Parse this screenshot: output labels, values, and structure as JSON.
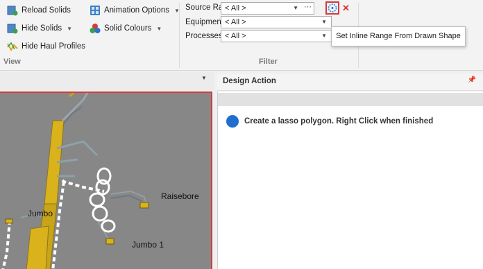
{
  "ribbon": {
    "view_group": {
      "label": "View",
      "reload_solids": "Reload Solids",
      "hide_solids": "Hide Solids",
      "hide_haul_profiles": "Hide Haul Profiles",
      "animation_options": "Animation Options",
      "solid_colours": "Solid Colours"
    },
    "filter_group": {
      "label": "Filter",
      "source_range_label": "Source Range",
      "source_range_value": "< All >",
      "source_range_more": "···",
      "equipment_label": "Equipment",
      "equipment_value": "< All >",
      "processes_label": "Processes",
      "processes_value": "< All >"
    }
  },
  "tooltip": {
    "text": "Set Inline Range From Drawn Shape"
  },
  "viewport": {
    "labels": [
      "Raisebore",
      "Jumbo",
      "Jumbo 1"
    ]
  },
  "design_action": {
    "title": "Design Action",
    "message": "Create a lasso polygon. Right Click when finished",
    "status_color": "#1f6fd0"
  },
  "colors": {
    "highlight": "#d43a3a",
    "accent": "#1f6fd0"
  }
}
